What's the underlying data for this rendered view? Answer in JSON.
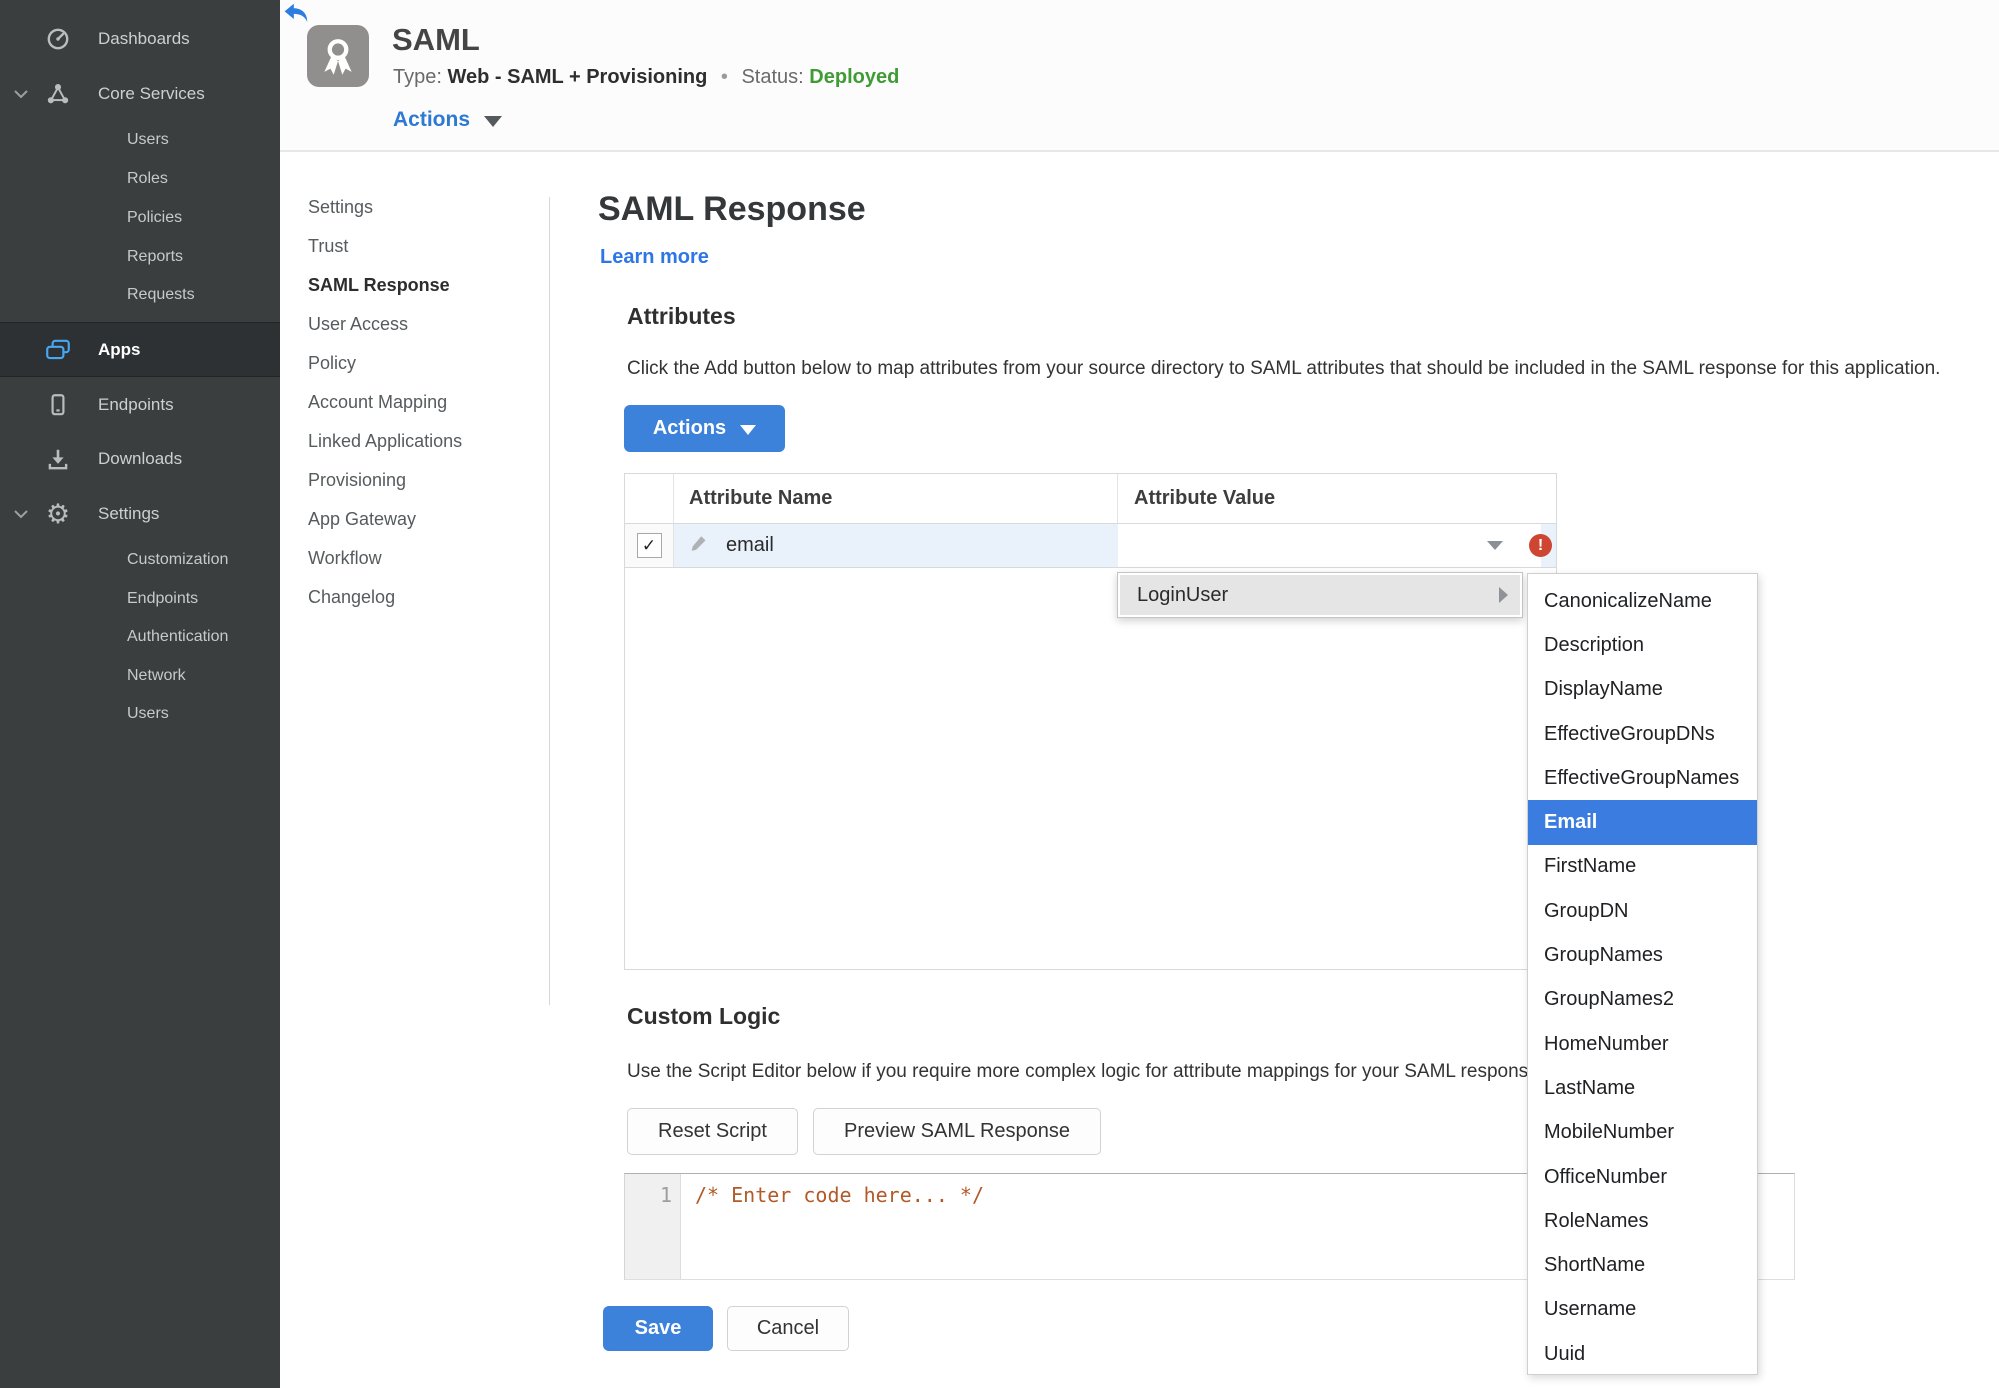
{
  "sidebar": {
    "items": [
      "Dashboards",
      "Core Services",
      "Users",
      "Roles",
      "Policies",
      "Reports",
      "Requests",
      "Apps",
      "Endpoints",
      "Downloads",
      "Settings",
      "Customization",
      "Endpoints",
      "Authentication",
      "Network",
      "Users"
    ],
    "active_item": "Apps"
  },
  "header": {
    "app_title": "SAML",
    "type_label": "Type:",
    "type_value": "Web - SAML + Provisioning",
    "separator": "•",
    "status_label": "Status:",
    "status_value": "Deployed",
    "actions_label": "Actions"
  },
  "subnav": {
    "items": [
      "Settings",
      "Trust",
      "SAML Response",
      "User Access",
      "Policy",
      "Account Mapping",
      "Linked Applications",
      "Provisioning",
      "App Gateway",
      "Workflow",
      "Changelog"
    ],
    "active_item": "SAML Response"
  },
  "main": {
    "page_title": "SAML Response",
    "learn_more_label": "Learn more",
    "attributes": {
      "heading": "Attributes",
      "description": "Click the Add button below to map attributes from your source directory to SAML attributes that should be included in the SAML response for this application.",
      "actions_button_label": "Actions"
    },
    "table": {
      "columns": [
        "Attribute Name",
        "Attribute Value"
      ],
      "rows": [
        {
          "name": "email",
          "value": "",
          "checked": true
        }
      ]
    },
    "value_menu": {
      "items": [
        "LoginUser"
      ]
    },
    "attribute_submenu": {
      "items": [
        "CanonicalizeName",
        "Description",
        "DisplayName",
        "EffectiveGroupDNs",
        "EffectiveGroupNames",
        "Email",
        "FirstName",
        "GroupDN",
        "GroupNames",
        "GroupNames2",
        "HomeNumber",
        "LastName",
        "MobileNumber",
        "OfficeNumber",
        "RoleNames",
        "ShortName",
        "Username",
        "Uuid"
      ],
      "selected_item": "Email"
    },
    "custom_logic": {
      "heading": "Custom Logic",
      "description": "Use the Script Editor below if you require more complex logic for attribute mappings for your SAML response.",
      "reset_button_label": "Reset Script",
      "preview_button_label": "Preview SAML Response"
    },
    "editor": {
      "line_number": "1",
      "code": "/* Enter code here... */"
    },
    "footer": {
      "save_button_label": "Save",
      "cancel_button_label": "Cancel"
    }
  },
  "icons": {
    "gear_glyph": "⚙",
    "check_glyph": "✓",
    "error_glyph": "!"
  },
  "colors": {
    "accent_blue": "#3c82db",
    "link_blue": "#2e75e6",
    "selected_blue": "#3b7ce0",
    "status_green": "#3f9c35",
    "error_red": "#ce4631",
    "row_highlight": "#e9f2fb",
    "sidebar_bg": "#3a3e3f",
    "sidebar_active_bg": "#2d3133",
    "code_orange": "#b25a28"
  }
}
